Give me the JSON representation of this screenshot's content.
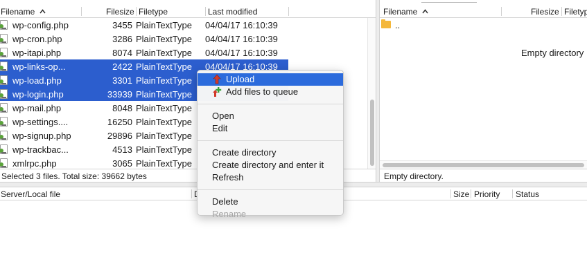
{
  "local": {
    "headers": {
      "filename": "Filename",
      "filesize": "Filesize",
      "filetype": "Filetype",
      "modified": "Last modified"
    },
    "rows": [
      {
        "name": "wp-config.php",
        "size": "3455",
        "type": "PlainTextType",
        "modified": "04/04/17 16:10:39",
        "selected": false
      },
      {
        "name": "wp-cron.php",
        "size": "3286",
        "type": "PlainTextType",
        "modified": "04/04/17 16:10:39",
        "selected": false
      },
      {
        "name": "wp-itapi.php",
        "size": "8074",
        "type": "PlainTextType",
        "modified": "04/04/17 16:10:39",
        "selected": false
      },
      {
        "name": "wp-links-op...",
        "size": "2422",
        "type": "PlainTextType",
        "modified": "04/04/17 16:10:39",
        "selected": true
      },
      {
        "name": "wp-load.php",
        "size": "3301",
        "type": "PlainTextType",
        "modified": "",
        "selected": true
      },
      {
        "name": "wp-login.php",
        "size": "33939",
        "type": "PlainTextType",
        "modified": "",
        "selected": true
      },
      {
        "name": "wp-mail.php",
        "size": "8048",
        "type": "PlainTextType",
        "modified": "",
        "selected": false
      },
      {
        "name": "wp-settings....",
        "size": "16250",
        "type": "PlainTextType",
        "modified": "",
        "selected": false
      },
      {
        "name": "wp-signup.php",
        "size": "29896",
        "type": "PlainTextType",
        "modified": "",
        "selected": false
      },
      {
        "name": "wp-trackbac...",
        "size": "4513",
        "type": "PlainTextType",
        "modified": "",
        "selected": false
      },
      {
        "name": "xmlrpc.php",
        "size": "3065",
        "type": "PlainTextType",
        "modified": "",
        "selected": false
      }
    ],
    "status": "Selected 3 files. Total size: 39662 bytes"
  },
  "remote": {
    "headers": {
      "filename": "Filename",
      "filesize": "Filesize",
      "filetype": "Filetyp"
    },
    "rows": [
      {
        "name": "..",
        "icon": "folder-icon"
      }
    ],
    "empty_message": "Empty directory",
    "status": "Empty directory."
  },
  "queue": {
    "headers": {
      "server_file": "Server/Local file",
      "direction": "D",
      "size": "Size",
      "priority": "Priority",
      "status": "Status"
    }
  },
  "context_menu": {
    "items": [
      {
        "label": "Upload",
        "icon": "upload-arrow-icon",
        "highlighted": true,
        "disabled": false
      },
      {
        "label": "Add files to queue",
        "icon": "add-to-queue-icon",
        "highlighted": false,
        "disabled": false
      },
      {
        "separator": true
      },
      {
        "label": "Open",
        "disabled": false
      },
      {
        "label": "Edit",
        "disabled": false
      },
      {
        "separator": true
      },
      {
        "label": "Create directory",
        "disabled": false
      },
      {
        "label": "Create directory and enter it",
        "disabled": false
      },
      {
        "label": "Refresh",
        "disabled": false
      },
      {
        "separator": true
      },
      {
        "label": "Delete",
        "disabled": false
      },
      {
        "label": "Rename",
        "disabled": true
      }
    ]
  },
  "colors": {
    "selection": "#2c5ece",
    "menu_highlight": "#2c6bdc",
    "upload_arrow": "#d23a2a",
    "add_plus": "#3aa33a"
  }
}
